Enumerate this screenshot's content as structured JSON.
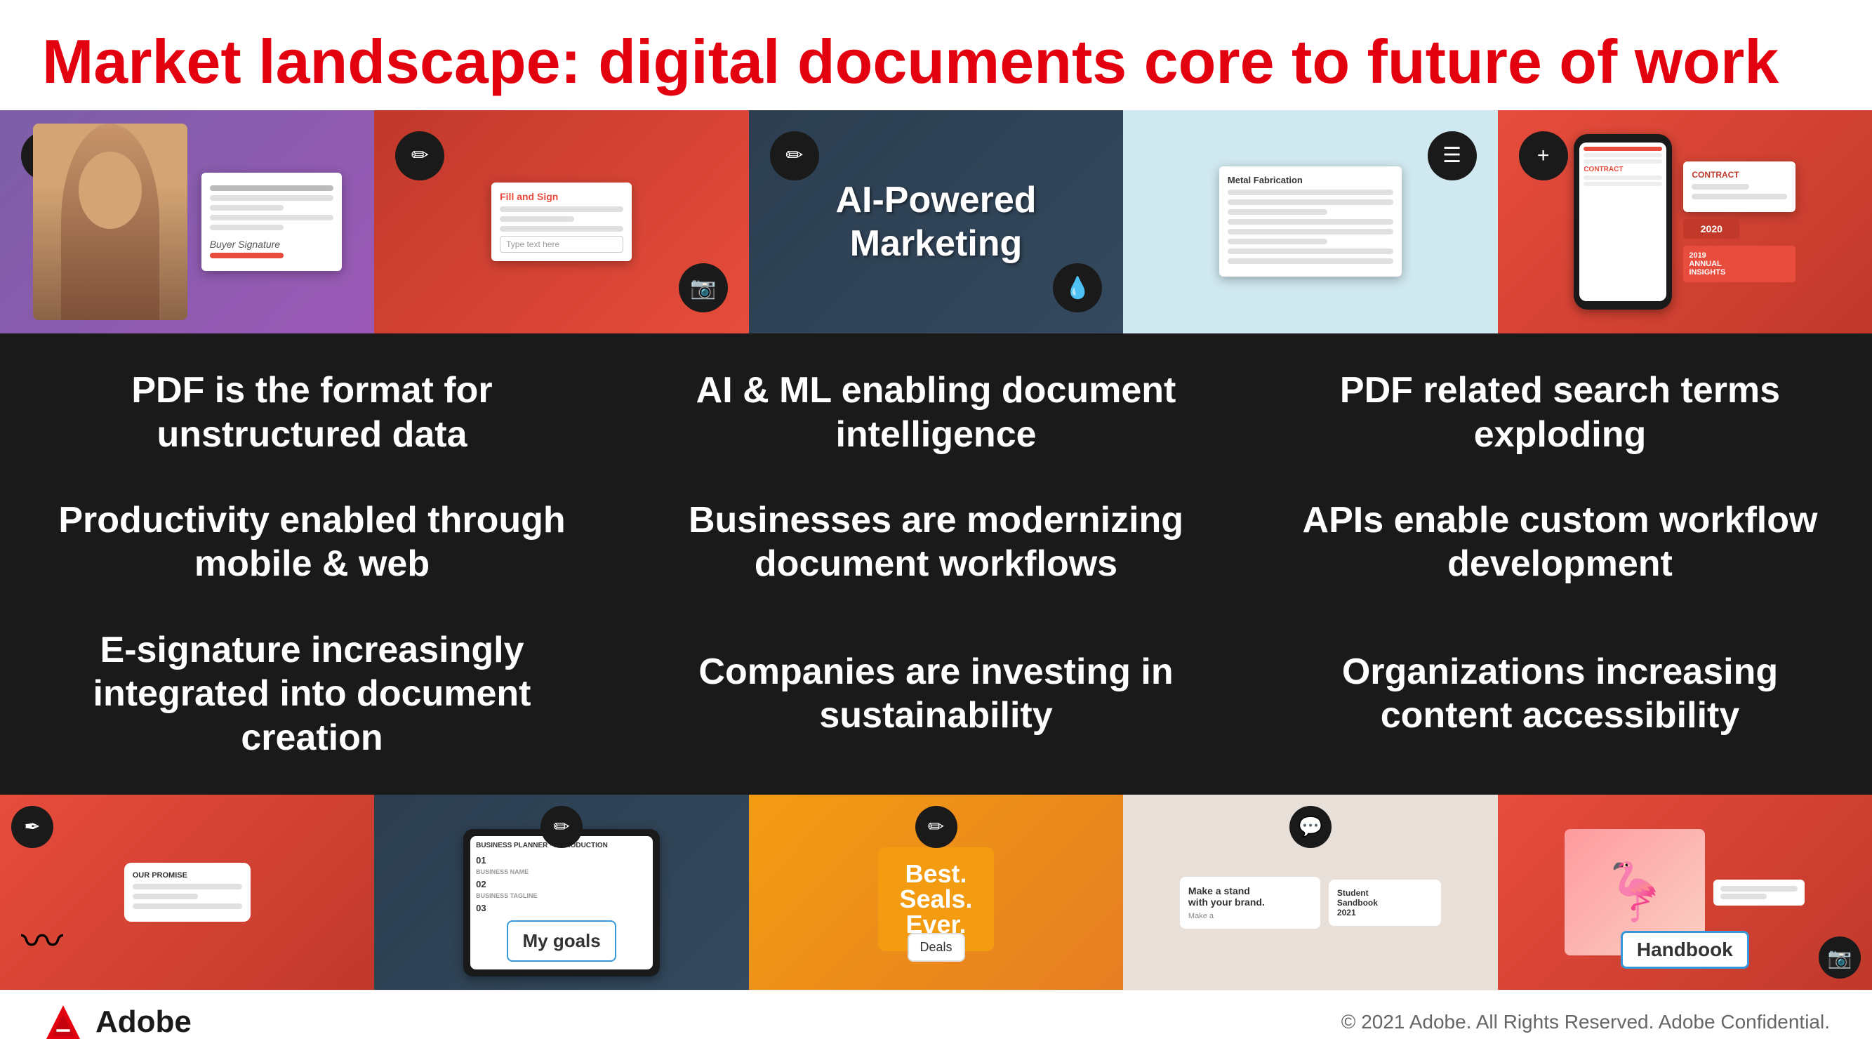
{
  "header": {
    "title": "Market landscape: digital documents core to future of work"
  },
  "stats": [
    {
      "id": "stat-1",
      "text": "PDF is the format for unstructured data"
    },
    {
      "id": "stat-2",
      "text": "AI & ML enabling document intelligence"
    },
    {
      "id": "stat-3",
      "text": "PDF related search terms exploding"
    },
    {
      "id": "stat-4",
      "text": "Productivity enabled through mobile & web"
    },
    {
      "id": "stat-5",
      "text": "Businesses are modernizing document workflows"
    },
    {
      "id": "stat-6",
      "text": "APIs enable custom workflow development"
    },
    {
      "id": "stat-7",
      "text": "E-signature increasingly integrated into document creation"
    },
    {
      "id": "stat-8",
      "text": "Companies are investing in sustainability"
    },
    {
      "id": "stat-9",
      "text": "Organizations increasing content accessibility"
    }
  ],
  "footer": {
    "adobe_label": "Adobe",
    "copyright": "© 2021 Adobe. All Rights Reserved. Adobe Confidential."
  },
  "banner": {
    "ai_text": "AI-Powered\nMarketing"
  },
  "bottom_cards": [
    {
      "id": "card-1",
      "text": "My goals"
    },
    {
      "id": "card-2",
      "text": "Handbook"
    }
  ]
}
